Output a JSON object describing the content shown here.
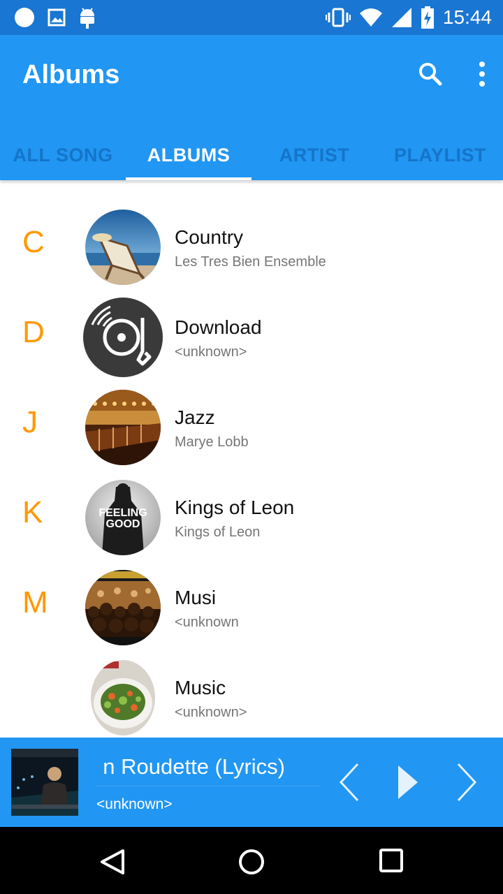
{
  "status_bar": {
    "time": "15:44",
    "left_icons": [
      "circle-notification-icon",
      "image-icon",
      "android-icon"
    ],
    "right_icons": [
      "vibrate-icon",
      "wifi-icon",
      "cell-signal-icon",
      "battery-charging-icon"
    ]
  },
  "app_bar": {
    "title": "Albums",
    "actions": [
      "search-icon",
      "more-vert-icon"
    ],
    "color": "#2196f3"
  },
  "tabs": [
    {
      "label": "ALL SONG",
      "active": false
    },
    {
      "label": "ALBUMS",
      "active": true
    },
    {
      "label": "ARTIST",
      "active": false
    },
    {
      "label": "PLAYLIST",
      "active": false
    }
  ],
  "albums": [
    {
      "letter": "C",
      "title": "Country",
      "artist": "Les Tres Bien Ensemble",
      "art": "beach-chair"
    },
    {
      "letter": "D",
      "title": "Download",
      "artist": "<unknown>",
      "art": "vinyl-record"
    },
    {
      "letter": "J",
      "title": "Jazz",
      "artist": "Marye Lobb",
      "art": "bar-interior"
    },
    {
      "letter": "K",
      "title": "Kings of Leon",
      "artist": "Kings of Leon",
      "art": "feeling-good-cover",
      "art_text": "FEELING GOOD"
    },
    {
      "letter": "M",
      "title": "Musi",
      "artist": "<unknown",
      "art": "concert-crowd"
    },
    {
      "letter": "",
      "title": "Music",
      "artist": "<unknown>",
      "art": "salad-plate"
    }
  ],
  "accent_color": "#ff9800",
  "now_playing": {
    "title": "n Roudette (Lyrics)",
    "artist": "<unknown>",
    "controls": [
      "previous-icon",
      "play-icon",
      "next-icon"
    ]
  },
  "nav_bar": [
    "back-icon",
    "home-icon",
    "recents-icon"
  ]
}
